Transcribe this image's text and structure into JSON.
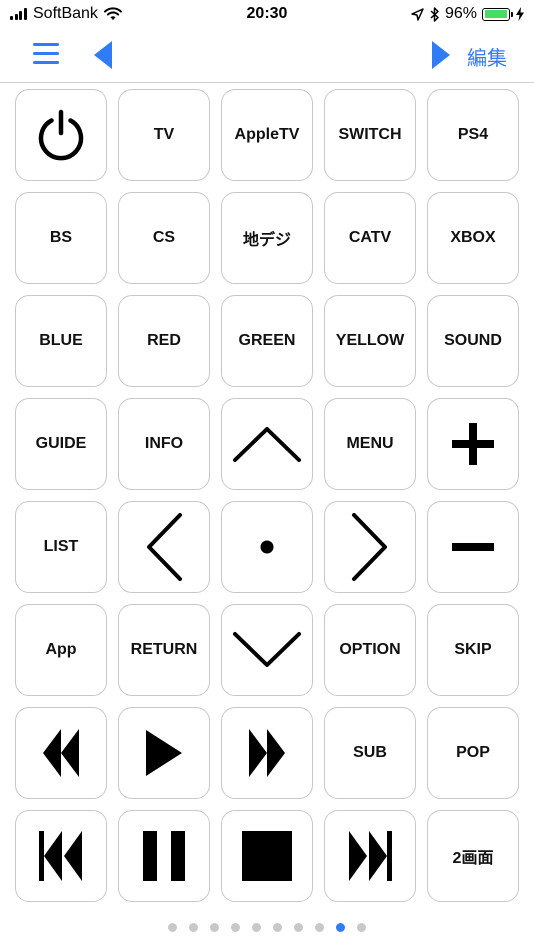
{
  "status_bar": {
    "carrier": "SoftBank",
    "time": "20:30",
    "battery": "96%",
    "battery_level": 0.96
  },
  "nav": {
    "edit_label": "編集",
    "accent_color": "#2f7cf6"
  },
  "keys": {
    "power": "power-icon",
    "tv": "TV",
    "appletv": "AppleTV",
    "switch": "SWITCH",
    "ps4": "PS4",
    "bs": "BS",
    "cs": "CS",
    "chideji": "地デジ",
    "catv": "CATV",
    "xbox": "XBOX",
    "blue": "BLUE",
    "red": "RED",
    "green": "GREEN",
    "yellow": "YELLOW",
    "sound": "SOUND",
    "guide": "GUIDE",
    "info": "INFO",
    "up": "chevron-up-icon",
    "menu": "MENU",
    "plus": "plus-icon",
    "list": "LIST",
    "left": "chevron-left-icon",
    "center": "dot-icon",
    "right": "chevron-right-icon",
    "minus": "minus-icon",
    "app": "App",
    "return": "RETURN",
    "down": "chevron-down-icon",
    "option": "OPTION",
    "skip": "SKIP",
    "rewind": "rewind-icon",
    "play": "play-icon",
    "fast_forward": "fast-forward-icon",
    "sub": "SUB",
    "pop": "POP",
    "previous": "skip-previous-icon",
    "pause": "pause-icon",
    "stop": "stop-icon",
    "next": "skip-next-icon",
    "dual_screen": "2画面"
  },
  "pagination": {
    "total_pages": 10,
    "active_page": 9
  }
}
